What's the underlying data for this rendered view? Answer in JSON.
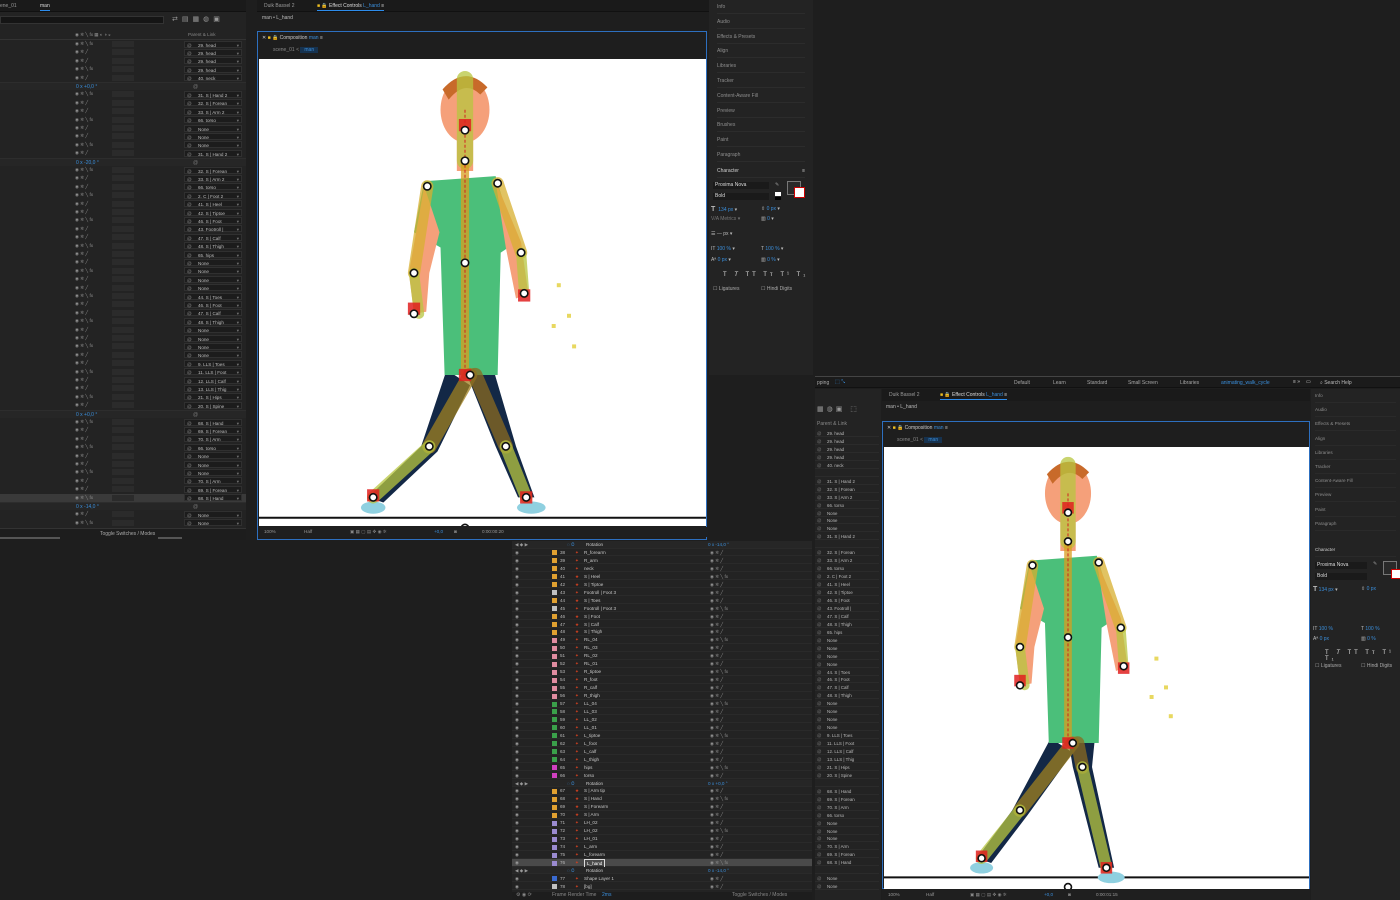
{
  "top_left_tabs": [
    "ene_01",
    "man"
  ],
  "timeline_left": {
    "header_col": "Parent & Link",
    "toggle_label": "Toggle Switches / Modes",
    "rows": [
      {
        "t": "p",
        "v": "29. head"
      },
      {
        "t": "p",
        "v": "29. head"
      },
      {
        "t": "p",
        "v": "29. head"
      },
      {
        "t": "p",
        "v": "29. head"
      },
      {
        "t": "p",
        "v": "40. neck"
      },
      {
        "t": "g",
        "v": "0 x +0,0 °"
      },
      {
        "t": "p",
        "v": "31. S | Hand 2"
      },
      {
        "t": "p",
        "v": "32. S | Forean"
      },
      {
        "t": "p",
        "v": "33. S | Arm 2"
      },
      {
        "t": "p",
        "v": "66. torso"
      },
      {
        "t": "p",
        "v": "None"
      },
      {
        "t": "p",
        "v": "None"
      },
      {
        "t": "p",
        "v": "None"
      },
      {
        "t": "p",
        "v": "31. S | Hand 2"
      },
      {
        "t": "g",
        "v": "0 x -20,0 °"
      },
      {
        "t": "p",
        "v": "32. S | Forean"
      },
      {
        "t": "p",
        "v": "33. S | Arm 2"
      },
      {
        "t": "p",
        "v": "66. torso"
      },
      {
        "t": "p",
        "v": "2. C | Foot 2"
      },
      {
        "t": "p",
        "v": "41. S | Heel"
      },
      {
        "t": "p",
        "v": "42. S | Tiptoe"
      },
      {
        "t": "p",
        "v": "46. S | Foot"
      },
      {
        "t": "p",
        "v": "43. Footroll |"
      },
      {
        "t": "p",
        "v": "47. S | Calf"
      },
      {
        "t": "p",
        "v": "48. S | Thigh"
      },
      {
        "t": "p",
        "v": "65. hips"
      },
      {
        "t": "p",
        "v": "None"
      },
      {
        "t": "p",
        "v": "None"
      },
      {
        "t": "p",
        "v": "None"
      },
      {
        "t": "p",
        "v": "None"
      },
      {
        "t": "p",
        "v": "44. S | Toes"
      },
      {
        "t": "p",
        "v": "46. S | Foot"
      },
      {
        "t": "p",
        "v": "47. S | Calf"
      },
      {
        "t": "p",
        "v": "48. S | Thigh"
      },
      {
        "t": "p",
        "v": "None"
      },
      {
        "t": "p",
        "v": "None"
      },
      {
        "t": "p",
        "v": "None"
      },
      {
        "t": "p",
        "v": "None"
      },
      {
        "t": "p",
        "v": "9. LLS | Toes"
      },
      {
        "t": "p",
        "v": "11. LLS | Foot"
      },
      {
        "t": "p",
        "v": "12. LLS | Calf"
      },
      {
        "t": "p",
        "v": "13. LLS | Thig"
      },
      {
        "t": "p",
        "v": "21. S | Hips"
      },
      {
        "t": "p",
        "v": "20. S | Spine"
      },
      {
        "t": "g",
        "v": "0 x +0,0 °"
      },
      {
        "t": "p",
        "v": "68. S | Hand"
      },
      {
        "t": "p",
        "v": "69. S | Forean"
      },
      {
        "t": "p",
        "v": "70. S | Arm"
      },
      {
        "t": "p",
        "v": "66. torso"
      },
      {
        "t": "p",
        "v": "None"
      },
      {
        "t": "p",
        "v": "None"
      },
      {
        "t": "p",
        "v": "None"
      },
      {
        "t": "p",
        "v": "70. S | Arm"
      },
      {
        "t": "p",
        "v": "69. S | Forean"
      },
      {
        "t": "p",
        "v": "68. S | Hand"
      },
      {
        "t": "g",
        "v": "0 x -14,0 °"
      },
      {
        "t": "p",
        "v": "None"
      },
      {
        "t": "p",
        "v": "None"
      }
    ]
  },
  "comp_left": {
    "tabs": [
      "Duik Bassel 2",
      "Effect Controls",
      "L_hand"
    ],
    "breadcrumb": "man • L_hand",
    "comp_tab": "Composition",
    "comp_name": "man",
    "flow": [
      "scene_01",
      "man"
    ],
    "zoom": "100%",
    "res": "Half",
    "exposure": "+0,0",
    "time": "0:00:00:20"
  },
  "right_panel_top": {
    "items": [
      "Info",
      "Audio",
      "Effects & Presets",
      "Align",
      "Libraries",
      "Tracker",
      "Content-Aware Fill",
      "Preview",
      "Brushes",
      "Paint",
      "Paragraph"
    ],
    "character": "Character",
    "font": "Proxima Nova",
    "style": "Bold",
    "size": "134 px",
    "kern": "Metrics",
    "lead": "0 px",
    "track": "0",
    "stroke": "px",
    "vscale": "100 %",
    "hscale": "100 %",
    "baseline": "0 px",
    "tsume": "0 %",
    "ligatures": "Ligatures",
    "hindi": "Hindi Digits"
  },
  "workspace_bar": {
    "items": [
      "Default",
      "Learn",
      "Standard",
      "Small Screen",
      "Libraries",
      "animating_walk_cycle"
    ],
    "search": "Search Help",
    "left": "pping"
  },
  "comp_right": {
    "tabs": [
      "Duik Bassel 2",
      "Effect Controls",
      "L_hand"
    ],
    "breadcrumb": "man • L_hand",
    "comp_tab": "Composition",
    "comp_name": "man",
    "flow": [
      "scene_01",
      "man"
    ],
    "zoom": "100%",
    "res": "Half",
    "exposure": "+0,0",
    "time": "0:00:01:15"
  },
  "right_panel_bottom": {
    "items": [
      "Info",
      "Audio",
      "Effects & Presets",
      "Align",
      "Libraries",
      "Tracker",
      "Content-Aware Fill",
      "Preview",
      "Paint",
      "Paragraph"
    ],
    "character": "Character",
    "font": "Proxima Nova",
    "style": "Bold",
    "size": "134 px",
    "lead": "0 px",
    "vscale": "100 %",
    "hscale": "100 %",
    "baseline": "0 px",
    "tsume": "0 %",
    "ligatures": "Ligatures",
    "hindi": "Hindi Digits"
  },
  "right_parent_list": [
    "29. head",
    "29. head",
    "29. head",
    "29. head",
    "40. neck",
    "",
    "31. S | Hand 2",
    "32. S | Forean",
    "33. S | Arm 2",
    "66. torso",
    "None",
    "None",
    "None",
    "31. S | Hand 2",
    "",
    "32. S | Forean",
    "33. S | Arm 2",
    "66. torso",
    "2. C | Foot 2",
    "41. S | Heel",
    "42. S | Tiptoe",
    "46. S | Foot",
    "43. Footroll |",
    "47. S | Calf",
    "48. S | Thigh",
    "65. hips",
    "None",
    "None",
    "None",
    "None",
    "44. S | Toes",
    "46. S | Foot",
    "47. S | Calf",
    "48. S | Thigh",
    "None",
    "None",
    "None",
    "None",
    "9. LLS | Toes",
    "11. LLS | Foot",
    "12. LLS | Calf",
    "13. LLS | Thig",
    "21. S | Hips",
    "20. S | Spine",
    "",
    "68. S | Hand",
    "69. S | Forean",
    "70. S | Arm",
    "66. torso",
    "None",
    "None",
    "None",
    "70. S | Arm",
    "69. S | Forean",
    "68. S | Hand",
    "",
    "None",
    "None"
  ],
  "layers": {
    "rows": [
      {
        "n": "",
        "name": "Rotation",
        "c": "#000",
        "g": true,
        "v": "0 x -14,0 °"
      },
      {
        "n": "38",
        "name": "R_forearm",
        "c": "#e0a030"
      },
      {
        "n": "39",
        "name": "R_arm",
        "c": "#e0a030"
      },
      {
        "n": "40",
        "name": "neck",
        "c": "#e0a030"
      },
      {
        "n": "41",
        "name": "S | Heel",
        "c": "#e0a030"
      },
      {
        "n": "42",
        "name": "S | Tiptoe",
        "c": "#e0a030"
      },
      {
        "n": "43",
        "name": "Footroll | Foot 3",
        "c": "#c0c0c0"
      },
      {
        "n": "44",
        "name": "S | Toes",
        "c": "#e0a030"
      },
      {
        "n": "45",
        "name": "Footroll | Foot 3",
        "c": "#c0c0c0"
      },
      {
        "n": "46",
        "name": "S | Foot",
        "c": "#e0a030"
      },
      {
        "n": "47",
        "name": "S | Calf",
        "c": "#e0a030"
      },
      {
        "n": "48",
        "name": "S | Thigh",
        "c": "#e0a030"
      },
      {
        "n": "49",
        "name": "RL_04",
        "c": "#e08ca0"
      },
      {
        "n": "50",
        "name": "RL_03",
        "c": "#e08ca0"
      },
      {
        "n": "51",
        "name": "RL_02",
        "c": "#e08ca0"
      },
      {
        "n": "52",
        "name": "RL_01",
        "c": "#e08ca0"
      },
      {
        "n": "53",
        "name": "R_tiptoe",
        "c": "#e08ca0"
      },
      {
        "n": "54",
        "name": "R_foot",
        "c": "#e08ca0"
      },
      {
        "n": "55",
        "name": "R_calf",
        "c": "#e08ca0"
      },
      {
        "n": "56",
        "name": "R_thigh",
        "c": "#e08ca0"
      },
      {
        "n": "57",
        "name": "LL_04",
        "c": "#3aa04a"
      },
      {
        "n": "58",
        "name": "LL_03",
        "c": "#3aa04a"
      },
      {
        "n": "59",
        "name": "LL_02",
        "c": "#3aa04a"
      },
      {
        "n": "60",
        "name": "LL_01",
        "c": "#3aa04a"
      },
      {
        "n": "61",
        "name": "L_tiptoe",
        "c": "#3aa04a"
      },
      {
        "n": "62",
        "name": "L_foot",
        "c": "#3aa04a"
      },
      {
        "n": "63",
        "name": "L_calf",
        "c": "#3aa04a"
      },
      {
        "n": "64",
        "name": "L_thigh",
        "c": "#3aa04a"
      },
      {
        "n": "65",
        "name": "hips",
        "c": "#d040c0"
      },
      {
        "n": "66",
        "name": "torso",
        "c": "#d040c0"
      },
      {
        "n": "",
        "name": "Rotation",
        "c": "#000",
        "g": true,
        "v": "0 x +0,0 °"
      },
      {
        "n": "67",
        "name": "S | Arm tip",
        "c": "#e0a030"
      },
      {
        "n": "68",
        "name": "S | Hand",
        "c": "#e0a030"
      },
      {
        "n": "69",
        "name": "S | Forearm",
        "c": "#e0a030"
      },
      {
        "n": "70",
        "name": "S | Arm",
        "c": "#e0a030"
      },
      {
        "n": "71",
        "name": "LH_02",
        "c": "#9a8ad0"
      },
      {
        "n": "72",
        "name": "LH_02",
        "c": "#9a8ad0"
      },
      {
        "n": "73",
        "name": "LH_01",
        "c": "#9a8ad0"
      },
      {
        "n": "74",
        "name": "L_arm",
        "c": "#9a8ad0"
      },
      {
        "n": "75",
        "name": "L_forearm",
        "c": "#9a8ad0"
      },
      {
        "n": "76",
        "name": "L_hand",
        "c": "#9a8ad0",
        "sel": true
      },
      {
        "n": "",
        "name": "Rotation",
        "c": "#000",
        "g": true,
        "v": "0 x -14,0 °"
      },
      {
        "n": "77",
        "name": "Shape Layer 1",
        "c": "#3a6ad0"
      },
      {
        "n": "78",
        "name": "[bg]",
        "c": "#c0c0c0"
      }
    ],
    "footer": "Frame Render Time",
    "render_time": "2ms",
    "toggle": "Toggle Switches / Modes"
  }
}
